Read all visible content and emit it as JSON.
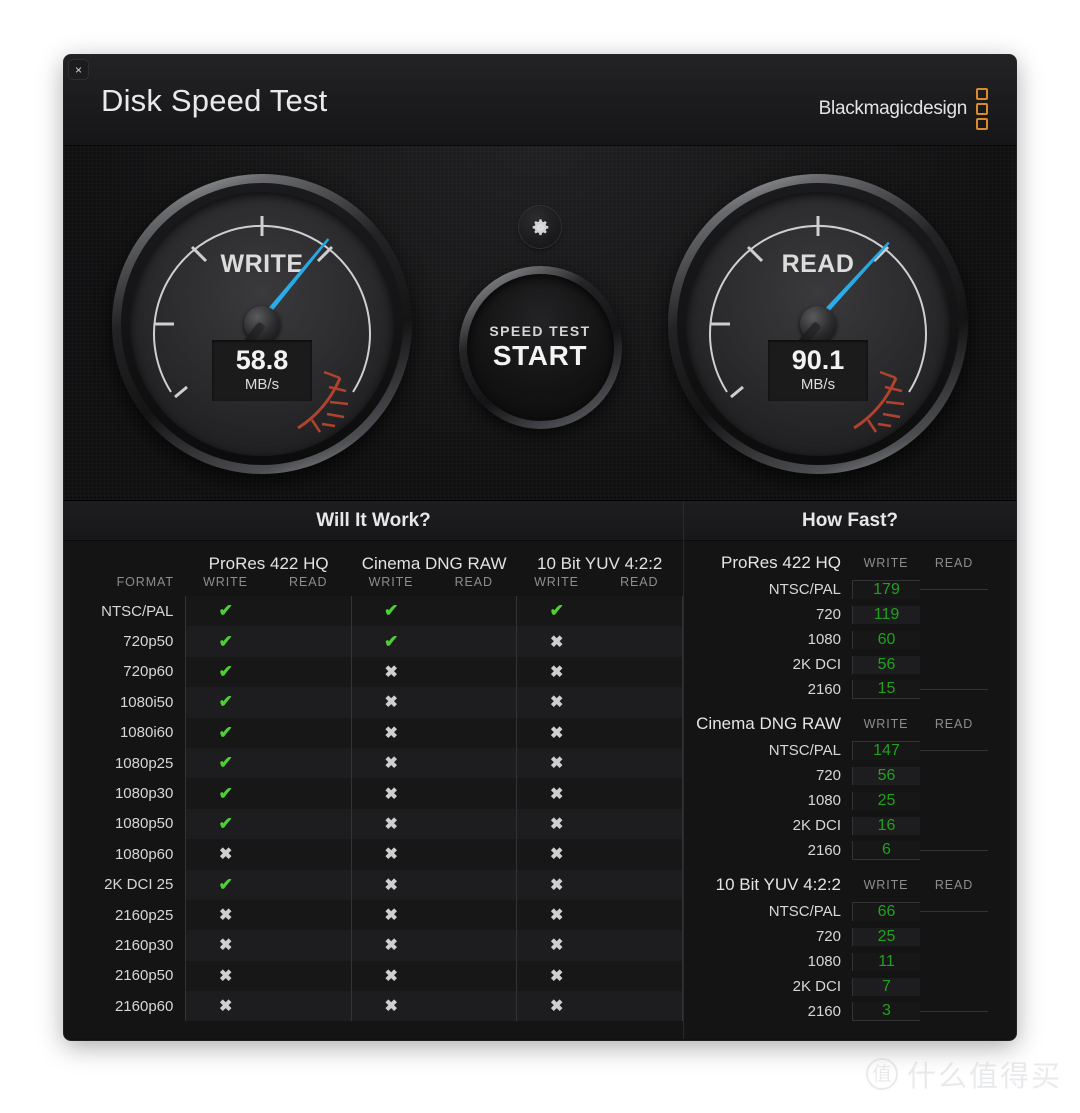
{
  "window": {
    "close_label": "×",
    "title": "Disk Speed Test",
    "brand": "Blackmagicdesign"
  },
  "gauges": {
    "write": {
      "label": "WRITE",
      "value": "58.8",
      "unit": "MB/s",
      "needle_angle_deg": 218
    },
    "read": {
      "label": "READ",
      "value": "90.1",
      "unit": "MB/s",
      "needle_angle_deg": 221
    },
    "gear_icon": "gear-icon",
    "start": {
      "small_label": "SPEED TEST",
      "big_label": "START"
    },
    "colors": {
      "needle": "#29a9e4",
      "redzone": "#b0432f"
    }
  },
  "will_it_work": {
    "title": "Will It Work?",
    "format_header": "FORMAT",
    "codecs": [
      {
        "name": "ProRes 422 HQ",
        "write_header": "WRITE",
        "read_header": "READ"
      },
      {
        "name": "Cinema DNG RAW",
        "write_header": "WRITE",
        "read_header": "READ"
      },
      {
        "name": "10 Bit YUV 4:2:2",
        "write_header": "WRITE",
        "read_header": "READ"
      }
    ],
    "marks": {
      "yes": "✔",
      "no": "✖"
    },
    "rows": [
      {
        "format": "NTSC/PAL",
        "cells": [
          "yes",
          "",
          "yes",
          "",
          "yes",
          ""
        ]
      },
      {
        "format": "720p50",
        "cells": [
          "yes",
          "",
          "yes",
          "",
          "no",
          ""
        ]
      },
      {
        "format": "720p60",
        "cells": [
          "yes",
          "",
          "no",
          "",
          "no",
          ""
        ]
      },
      {
        "format": "1080i50",
        "cells": [
          "yes",
          "",
          "no",
          "",
          "no",
          ""
        ]
      },
      {
        "format": "1080i60",
        "cells": [
          "yes",
          "",
          "no",
          "",
          "no",
          ""
        ]
      },
      {
        "format": "1080p25",
        "cells": [
          "yes",
          "",
          "no",
          "",
          "no",
          ""
        ]
      },
      {
        "format": "1080p30",
        "cells": [
          "yes",
          "",
          "no",
          "",
          "no",
          ""
        ]
      },
      {
        "format": "1080p50",
        "cells": [
          "yes",
          "",
          "no",
          "",
          "no",
          ""
        ]
      },
      {
        "format": "1080p60",
        "cells": [
          "no",
          "",
          "no",
          "",
          "no",
          ""
        ]
      },
      {
        "format": "2K DCI 25",
        "cells": [
          "yes",
          "",
          "no",
          "",
          "no",
          ""
        ]
      },
      {
        "format": "2160p25",
        "cells": [
          "no",
          "",
          "no",
          "",
          "no",
          ""
        ]
      },
      {
        "format": "2160p30",
        "cells": [
          "no",
          "",
          "no",
          "",
          "no",
          ""
        ]
      },
      {
        "format": "2160p50",
        "cells": [
          "no",
          "",
          "no",
          "",
          "no",
          ""
        ]
      },
      {
        "format": "2160p60",
        "cells": [
          "no",
          "",
          "no",
          "",
          "no",
          ""
        ]
      }
    ]
  },
  "how_fast": {
    "title": "How Fast?",
    "write_header": "WRITE",
    "read_header": "READ",
    "groups": [
      {
        "name": "ProRes 422 HQ",
        "rows": [
          {
            "format": "NTSC/PAL",
            "write": "179",
            "read": ""
          },
          {
            "format": "720",
            "write": "119",
            "read": ""
          },
          {
            "format": "1080",
            "write": "60",
            "read": ""
          },
          {
            "format": "2K DCI",
            "write": "56",
            "read": ""
          },
          {
            "format": "2160",
            "write": "15",
            "read": ""
          }
        ]
      },
      {
        "name": "Cinema DNG RAW",
        "rows": [
          {
            "format": "NTSC/PAL",
            "write": "147",
            "read": ""
          },
          {
            "format": "720",
            "write": "56",
            "read": ""
          },
          {
            "format": "1080",
            "write": "25",
            "read": ""
          },
          {
            "format": "2K DCI",
            "write": "16",
            "read": ""
          },
          {
            "format": "2160",
            "write": "6",
            "read": ""
          }
        ]
      },
      {
        "name": "10 Bit YUV 4:2:2",
        "rows": [
          {
            "format": "NTSC/PAL",
            "write": "66",
            "read": ""
          },
          {
            "format": "720",
            "write": "25",
            "read": ""
          },
          {
            "format": "1080",
            "write": "11",
            "read": ""
          },
          {
            "format": "2K DCI",
            "write": "7",
            "read": ""
          },
          {
            "format": "2160",
            "write": "3",
            "read": ""
          }
        ]
      }
    ]
  },
  "watermark": {
    "badge": "值",
    "text": "什么值得买"
  }
}
